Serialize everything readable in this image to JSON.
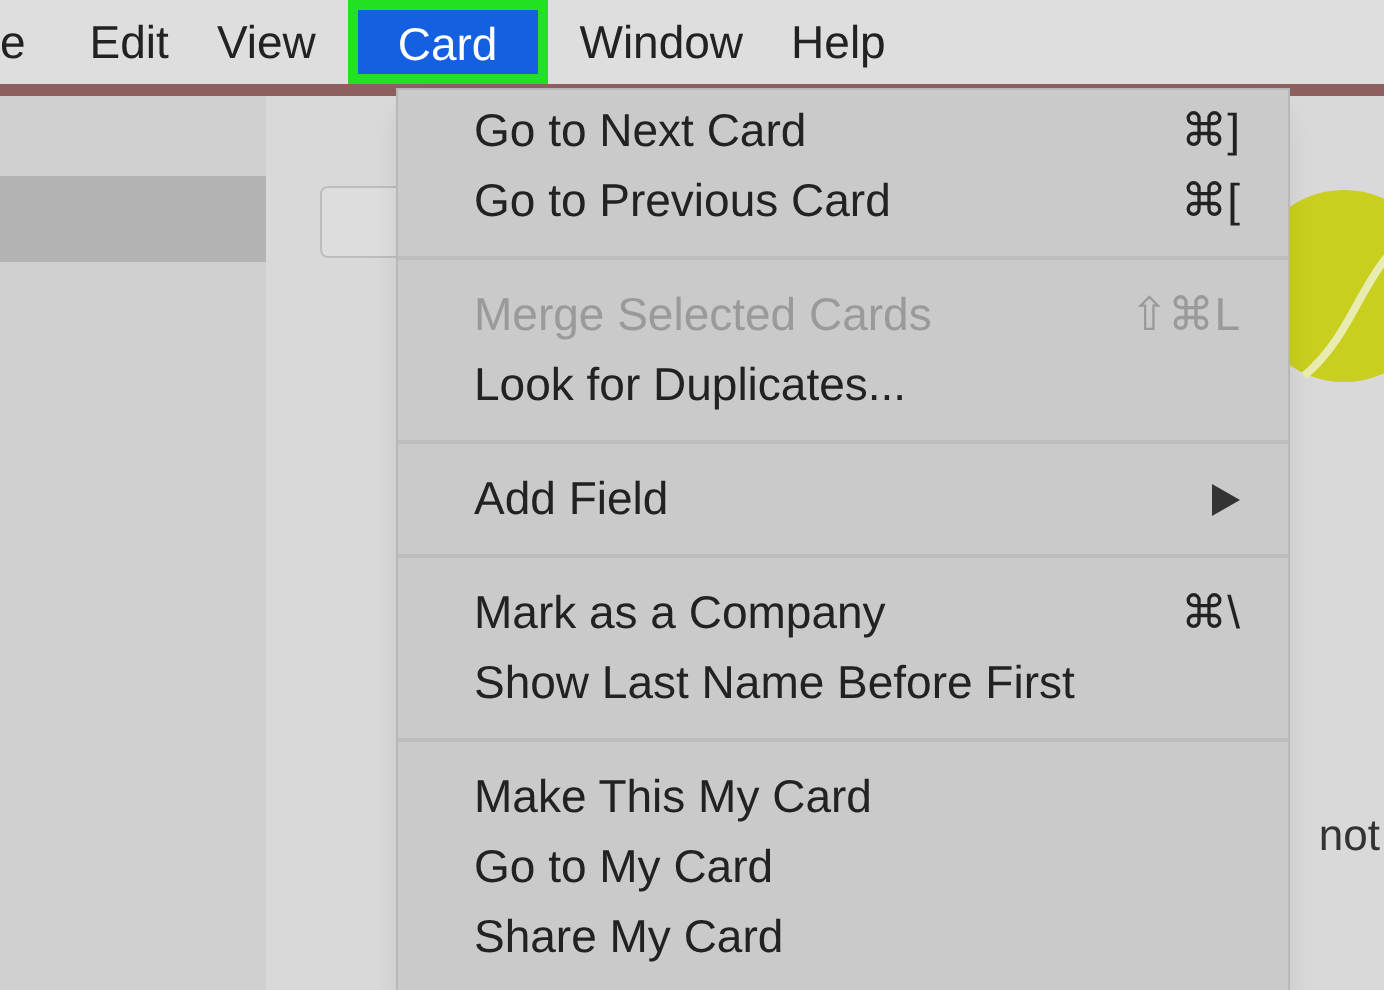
{
  "menu_bar": [
    {
      "label": "e",
      "selected": false
    },
    {
      "label": "Edit",
      "selected": false
    },
    {
      "label": "View",
      "selected": false
    },
    {
      "label": "Card",
      "selected": true
    },
    {
      "label": "Window",
      "selected": false
    },
    {
      "label": "Help",
      "selected": false
    }
  ],
  "card_menu": {
    "sections": [
      [
        {
          "label": "Go to Next Card",
          "shortcut": "⌘]",
          "disabled": false,
          "submenu": false
        },
        {
          "label": "Go to Previous Card",
          "shortcut": "⌘[",
          "disabled": false,
          "submenu": false
        }
      ],
      [
        {
          "label": "Merge Selected Cards",
          "shortcut": "⇧⌘L",
          "disabled": true,
          "submenu": false
        },
        {
          "label": "Look for Duplicates...",
          "disabled": false,
          "submenu": false
        }
      ],
      [
        {
          "label": "Add Field",
          "disabled": false,
          "submenu": true
        }
      ],
      [
        {
          "label": "Mark as a Company",
          "shortcut": "⌘\\",
          "disabled": false,
          "submenu": false
        },
        {
          "label": "Show Last Name Before First",
          "disabled": false,
          "submenu": false
        }
      ],
      [
        {
          "label": "Make This My Card",
          "disabled": false,
          "submenu": false
        },
        {
          "label": "Go to My Card",
          "disabled": false,
          "submenu": false
        },
        {
          "label": "Share My Card",
          "disabled": false,
          "submenu": false
        }
      ]
    ]
  },
  "background_text": "not"
}
